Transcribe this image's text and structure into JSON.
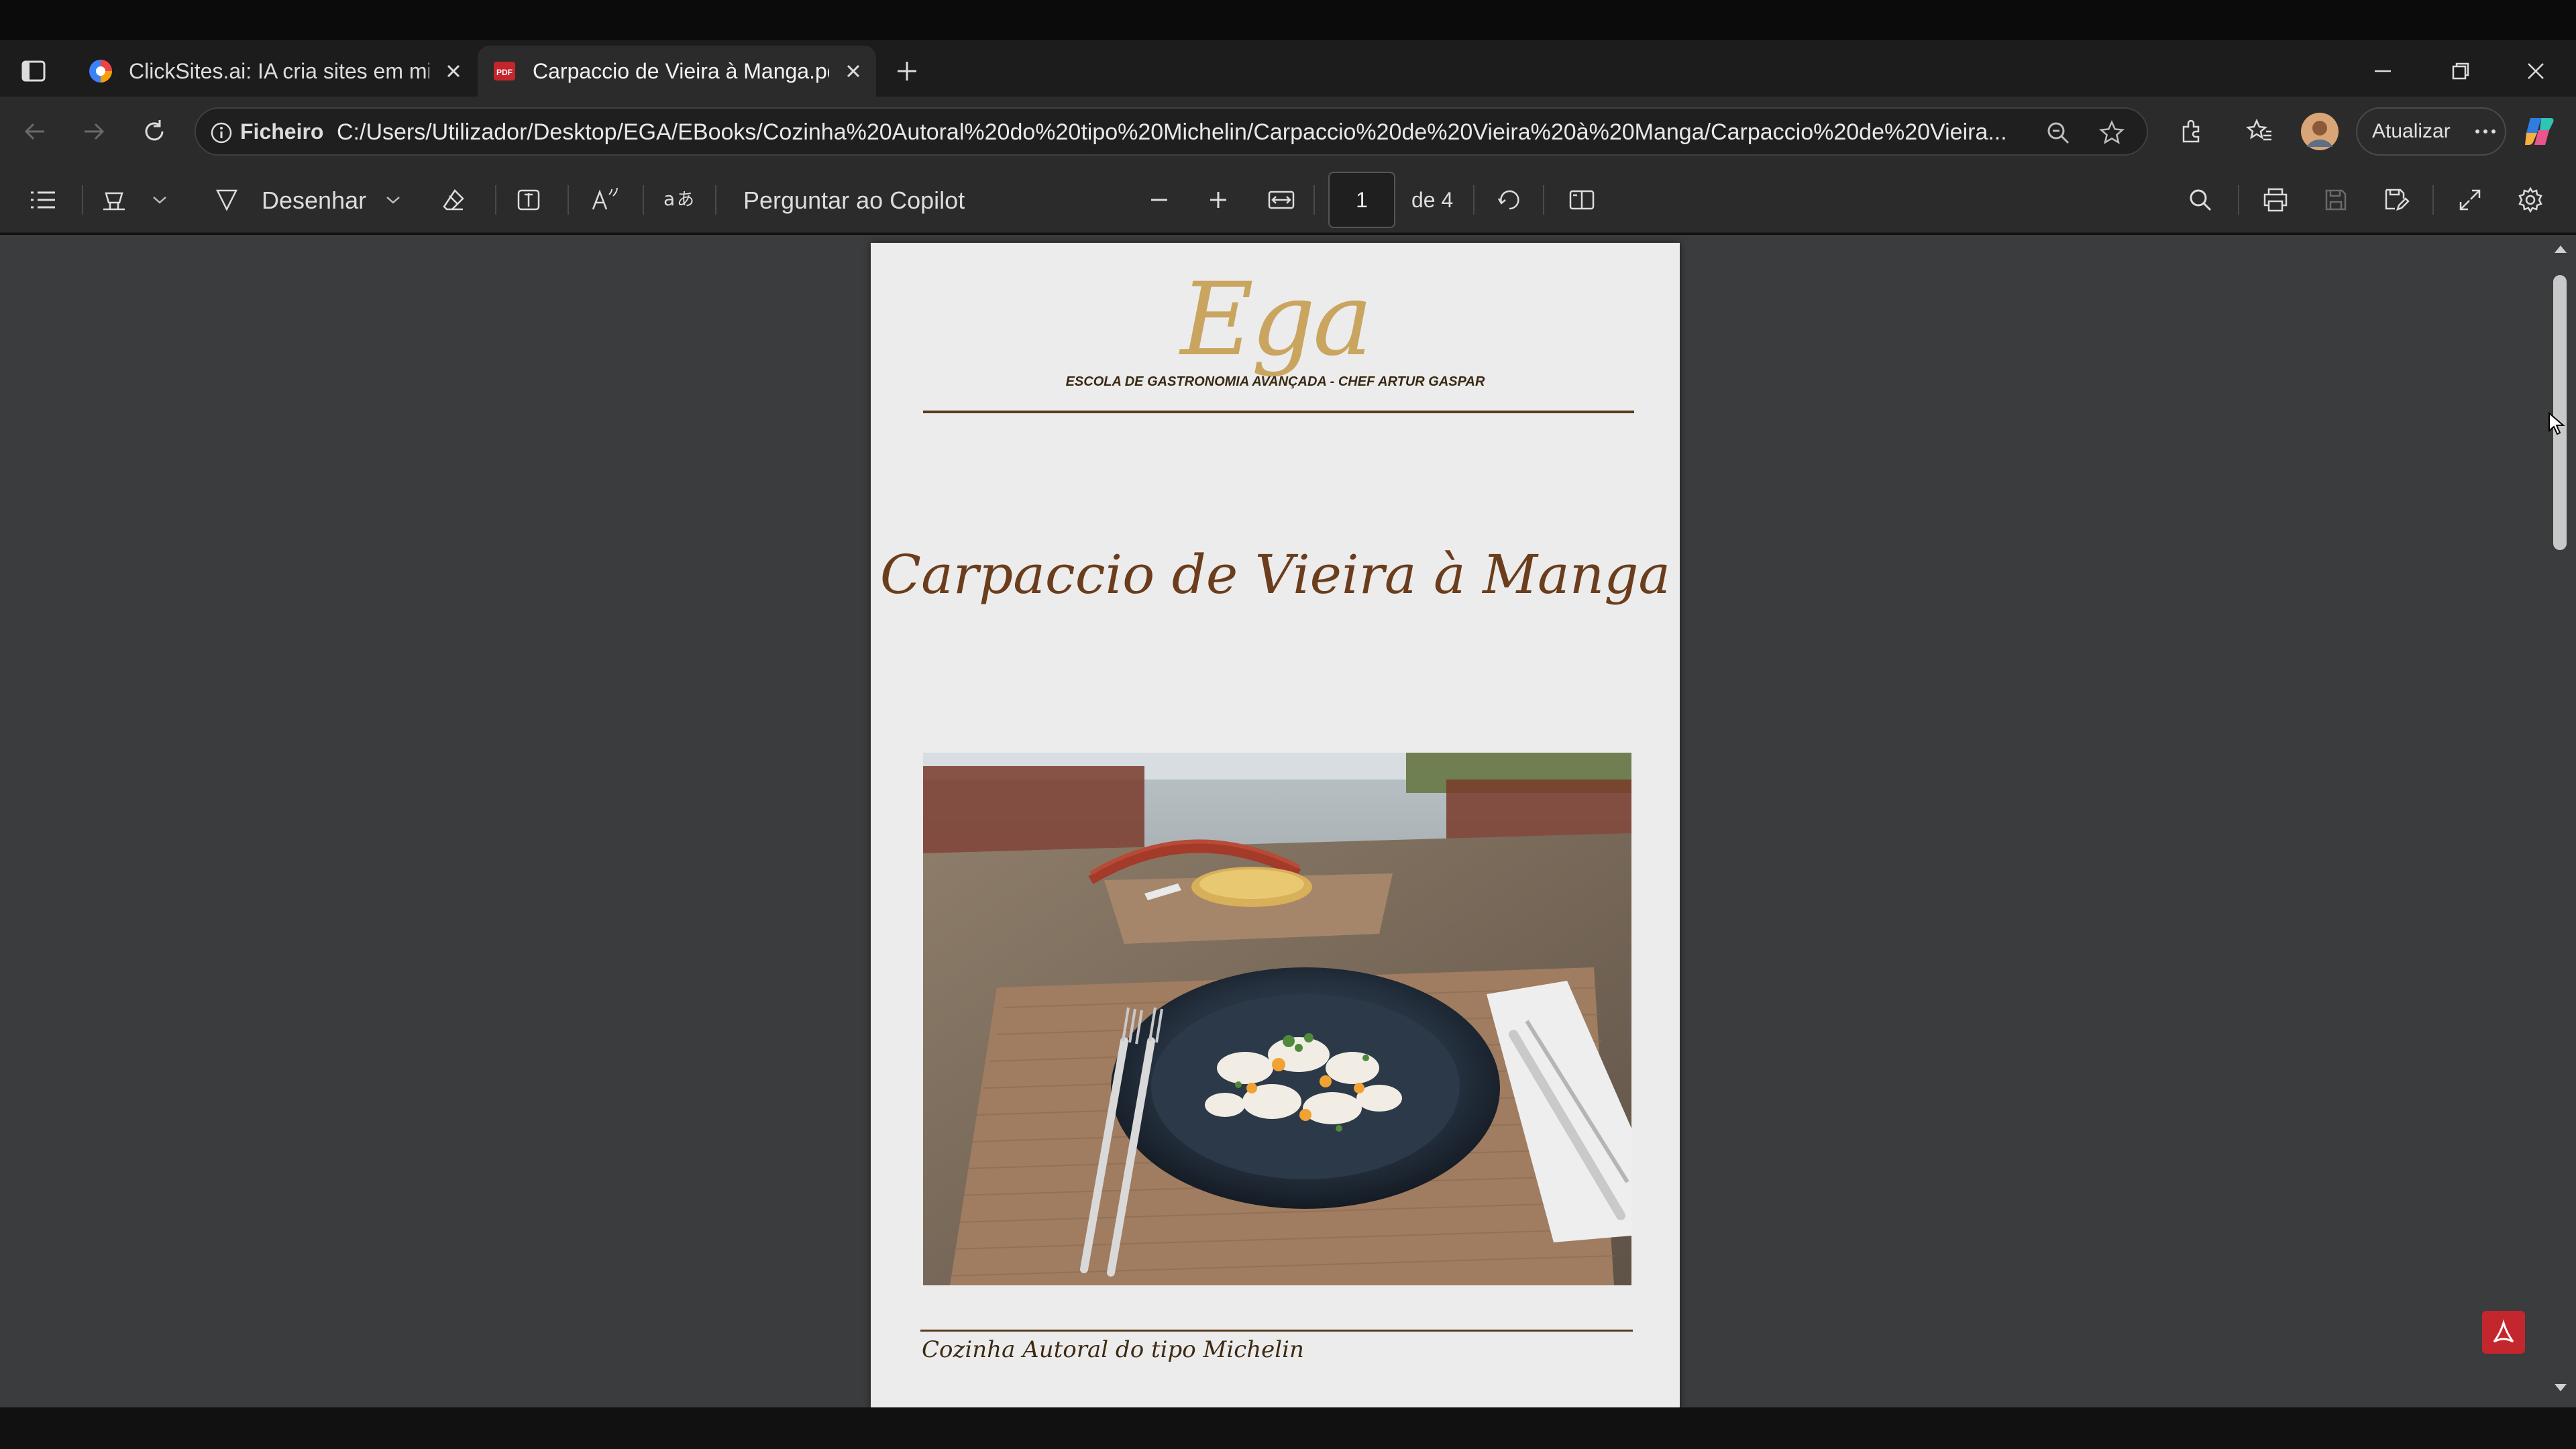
{
  "tabs": [
    {
      "title": "ClickSites.ai: IA cria sites em minu",
      "favicon": "chrome-like-favicon"
    },
    {
      "title": "Carpaccio de Vieira à Manga.pdf",
      "favicon": "pdf-favicon",
      "active": true
    }
  ],
  "address": {
    "scheme_label": "Ficheiro",
    "url": "C:/Users/Utilizador/Desktop/EGA/EBooks/Cozinha%20Autoral%20do%20tipo%20Michelin/Carpaccio%20de%20Vieira%20à%20Manga/Carpaccio%20de%20Vieira..."
  },
  "profile": {
    "update_label": "Atualizar"
  },
  "pdf_toolbar": {
    "draw_label": "Desenhar",
    "copilot_label": "Perguntar ao Copilot",
    "page_current": "1",
    "page_total_label": "de 4"
  },
  "document": {
    "logo_text": "Ega",
    "logo_subtitle": "ESCOLA DE GASTRONOMIA AVANÇADA - CHEF ARTUR GASPAR",
    "title": "Carpaccio de Vieira à Manga",
    "footer": "Cozinha Autoral do tipo Michelin"
  },
  "colors": {
    "tab_strip": "#1c1c1c",
    "toolbar": "#2b2b2b",
    "viewer_bg": "#3a3c3d",
    "page_bg": "#ececec",
    "logo_gold": "#c9a560",
    "title_brown": "#6b3d1c",
    "pdf_red": "#c4262e"
  }
}
